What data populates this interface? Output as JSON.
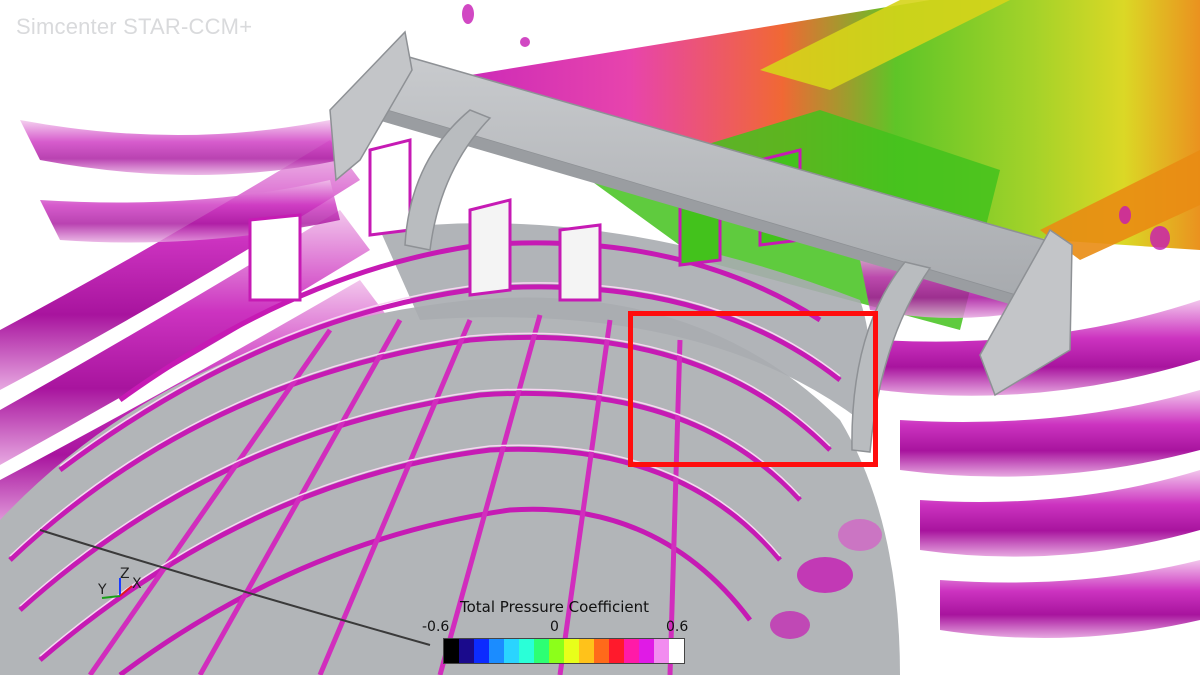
{
  "app": {
    "watermark": "Simcenter STAR-CCM+"
  },
  "view": {
    "axes": {
      "z_label": "Z",
      "y_label": "Y",
      "x_label": "X"
    }
  },
  "legend": {
    "title": "Total Pressure Coefficient",
    "min_label": "-0.6",
    "mid_label": "0",
    "max_label": "0.6",
    "min_value": -0.6,
    "mid_value": 0,
    "max_value": 0.6,
    "colormap": [
      "#000000",
      "#1a0a8c",
      "#0c2bff",
      "#1b8cff",
      "#2ad4ff",
      "#2affd8",
      "#2dff73",
      "#8cff1a",
      "#e8ff1a",
      "#ffc21a",
      "#ff6a1a",
      "#ff1a2c",
      "#ff1aa8",
      "#e01ae6",
      "#f28cf0",
      "#ffffff"
    ]
  },
  "colors": {
    "surface_grey": "#b2b5b8",
    "field_magenta": "#c61ab4",
    "field_green": "#43c21c",
    "field_yellow": "#d6d41a",
    "field_orange": "#e98c13",
    "highlight_red": "#ff0d0d"
  },
  "annotations": {
    "highlight_box": "red rectangle around the right wing-mount stand wake region"
  }
}
